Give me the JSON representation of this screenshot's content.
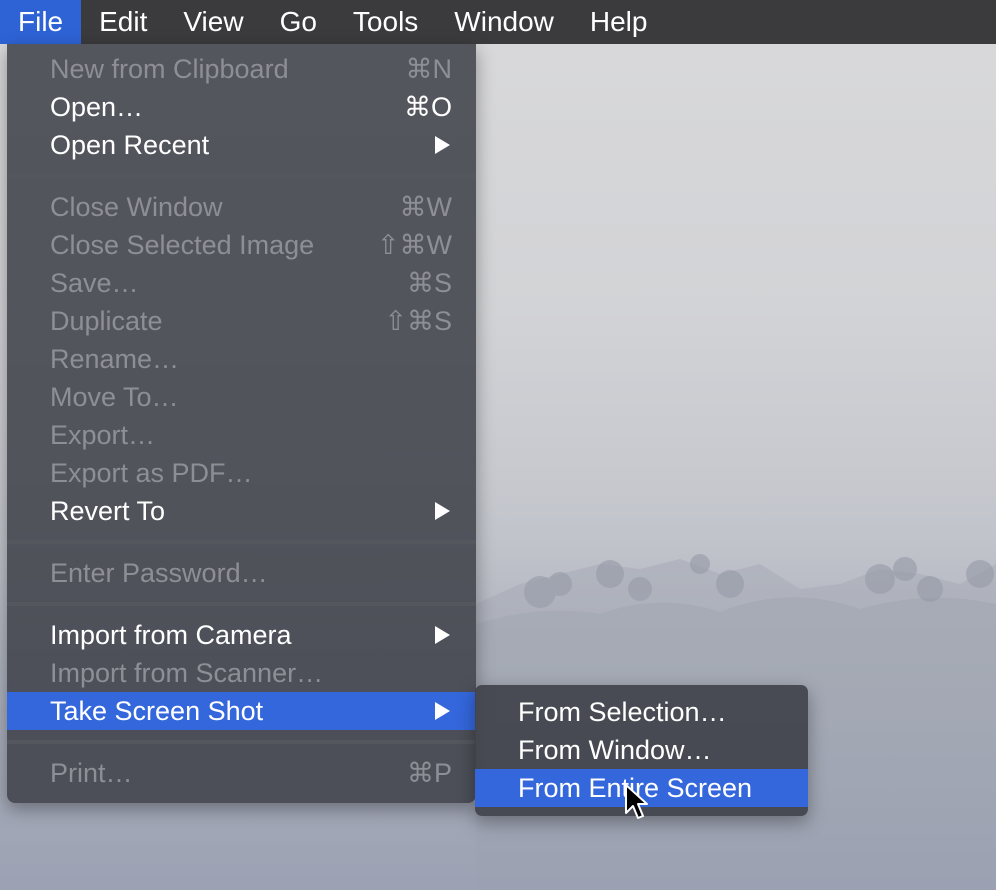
{
  "menubar": {
    "items": [
      "File",
      "Edit",
      "View",
      "Go",
      "Tools",
      "Window",
      "Help"
    ],
    "active": "File"
  },
  "file_menu": {
    "new_from_clipboard": {
      "label": "New from Clipboard",
      "shortcut": "⌘N"
    },
    "open": {
      "label": "Open…",
      "shortcut": "⌘O"
    },
    "open_recent": {
      "label": "Open Recent"
    },
    "close_window": {
      "label": "Close Window",
      "shortcut": "⌘W"
    },
    "close_selected_image": {
      "label": "Close Selected Image",
      "shortcut": "⇧⌘W"
    },
    "save": {
      "label": "Save…",
      "shortcut": "⌘S"
    },
    "duplicate": {
      "label": "Duplicate",
      "shortcut": "⇧⌘S"
    },
    "rename": {
      "label": "Rename…"
    },
    "move_to": {
      "label": "Move To…"
    },
    "export": {
      "label": "Export…"
    },
    "export_pdf": {
      "label": "Export as PDF…"
    },
    "revert_to": {
      "label": "Revert To"
    },
    "enter_password": {
      "label": "Enter Password…"
    },
    "import_camera": {
      "label": "Import from Camera"
    },
    "import_scanner": {
      "label": "Import from Scanner…"
    },
    "take_screenshot": {
      "label": "Take Screen Shot"
    },
    "print": {
      "label": "Print…",
      "shortcut": "⌘P"
    }
  },
  "screenshot_submenu": {
    "from_selection": "From Selection…",
    "from_window": "From Window…",
    "from_entire_screen": "From Entire Screen"
  },
  "colors": {
    "highlight": "#3467dc",
    "menu_bg": "#3e4048",
    "disabled_text": "#8e8f96"
  }
}
